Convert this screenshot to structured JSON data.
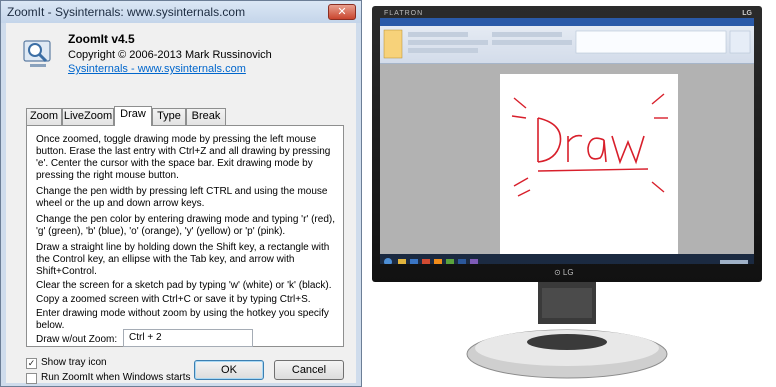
{
  "dialog": {
    "title": "ZoomIt - Sysinternals: www.sysinternals.com",
    "close_glyph": "✕",
    "app_name": "ZoomIt v4.5",
    "copyright": "Copyright © 2006-2013 Mark Russinovich",
    "link": "Sysinternals - www.sysinternals.com",
    "icon": "zoomit-app-icon",
    "tabs": [
      {
        "label": "Zoom"
      },
      {
        "label": "LiveZoom"
      },
      {
        "label": "Draw",
        "active": true
      },
      {
        "label": "Type"
      },
      {
        "label": "Break"
      }
    ],
    "paragraphs": [
      "Once zoomed, toggle drawing mode by pressing the left mouse button. Erase the last entry with Ctrl+Z and all drawing by pressing 'e'. Center the cursor with the space bar. Exit drawing mode by pressing the right mouse button.",
      "Change the pen width by pressing left CTRL and using the mouse wheel or the up and down arrow keys.",
      "Change the pen color by entering drawing mode and typing 'r' (red), 'g' (green), 'b' (blue), 'o' (orange), 'y' (yellow) or 'p' (pink).",
      "Draw a straight line by holding down the Shift key, a rectangle with the Control key, an ellipse with the Tab key, and arrow with Shift+Control.",
      "Clear the screen for a sketch pad by typing 'w' (white) or 'k' (black).",
      "Copy a zoomed screen with Ctrl+C or save it by typing Ctrl+S.",
      "Enter drawing mode without zoom by using the hotkey you specify below."
    ],
    "draw_without_zoom_label": "Draw w/out Zoom:",
    "draw_without_zoom_value": "Ctrl + 2",
    "show_tray_icon": {
      "label": "Show tray icon",
      "checked": true,
      "glyph": "✓"
    },
    "run_at_start": {
      "label": "Run ZoomIt when Windows starts",
      "checked": false
    },
    "ok_label": "OK",
    "cancel_label": "Cancel"
  },
  "photo": {
    "brand_tag": "FLATRON",
    "corner_logo": "LG",
    "stand_logo": "⊙ LG",
    "handwritten_word": "Draw",
    "ink_color": "#d81f2b",
    "accent": "#2a5aa8"
  }
}
